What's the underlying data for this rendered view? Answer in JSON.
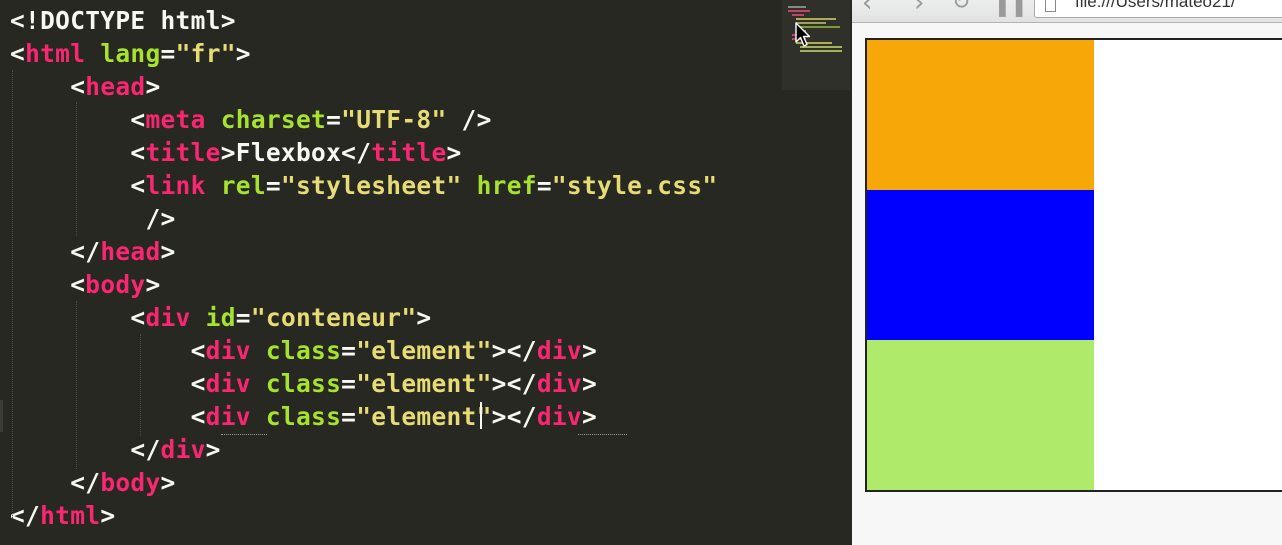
{
  "editor": {
    "lines": [
      [
        {
          "t": "<!DOCTYPE html>",
          "c": "text"
        }
      ],
      [
        {
          "t": "<",
          "c": "pun"
        },
        {
          "t": "html",
          "c": "tag"
        },
        {
          "t": " ",
          "c": "pun"
        },
        {
          "t": "lang",
          "c": "attr"
        },
        {
          "t": "=",
          "c": "pun"
        },
        {
          "t": "\"fr\"",
          "c": "str"
        },
        {
          "t": ">",
          "c": "pun"
        }
      ],
      [
        {
          "t": "    <",
          "c": "pun"
        },
        {
          "t": "head",
          "c": "tag"
        },
        {
          "t": ">",
          "c": "pun"
        }
      ],
      [
        {
          "t": "        <",
          "c": "pun"
        },
        {
          "t": "meta",
          "c": "tag"
        },
        {
          "t": " ",
          "c": "pun"
        },
        {
          "t": "charset",
          "c": "attr"
        },
        {
          "t": "=",
          "c": "pun"
        },
        {
          "t": "\"UTF-8\"",
          "c": "str"
        },
        {
          "t": " />",
          "c": "pun"
        }
      ],
      [
        {
          "t": "        <",
          "c": "pun"
        },
        {
          "t": "title",
          "c": "tag"
        },
        {
          "t": ">",
          "c": "pun"
        },
        {
          "t": "Flexbox",
          "c": "text"
        },
        {
          "t": "</",
          "c": "pun"
        },
        {
          "t": "title",
          "c": "tag"
        },
        {
          "t": ">",
          "c": "pun"
        }
      ],
      [
        {
          "t": "        <",
          "c": "pun"
        },
        {
          "t": "link",
          "c": "tag"
        },
        {
          "t": " ",
          "c": "pun"
        },
        {
          "t": "rel",
          "c": "attr"
        },
        {
          "t": "=",
          "c": "pun"
        },
        {
          "t": "\"stylesheet\"",
          "c": "str"
        },
        {
          "t": " ",
          "c": "pun"
        },
        {
          "t": "href",
          "c": "attr"
        },
        {
          "t": "=",
          "c": "pun"
        },
        {
          "t": "\"style.css\"",
          "c": "str"
        }
      ],
      [
        {
          "t": "         />",
          "c": "pun"
        }
      ],
      [
        {
          "t": "    </",
          "c": "pun"
        },
        {
          "t": "head",
          "c": "tag"
        },
        {
          "t": ">",
          "c": "pun"
        }
      ],
      [
        {
          "t": "    <",
          "c": "pun"
        },
        {
          "t": "body",
          "c": "tag"
        },
        {
          "t": ">",
          "c": "pun"
        }
      ],
      [
        {
          "t": "        <",
          "c": "pun"
        },
        {
          "t": "div",
          "c": "tag"
        },
        {
          "t": " ",
          "c": "pun"
        },
        {
          "t": "id",
          "c": "attr"
        },
        {
          "t": "=",
          "c": "pun"
        },
        {
          "t": "\"conteneur\"",
          "c": "str"
        },
        {
          "t": ">",
          "c": "pun"
        }
      ],
      [
        {
          "t": "            <",
          "c": "pun"
        },
        {
          "t": "div",
          "c": "tag"
        },
        {
          "t": " ",
          "c": "pun"
        },
        {
          "t": "class",
          "c": "attr"
        },
        {
          "t": "=",
          "c": "pun"
        },
        {
          "t": "\"element\"",
          "c": "str"
        },
        {
          "t": "></",
          "c": "pun"
        },
        {
          "t": "div",
          "c": "tag"
        },
        {
          "t": ">",
          "c": "pun"
        }
      ],
      [
        {
          "t": "            <",
          "c": "pun"
        },
        {
          "t": "div",
          "c": "tag"
        },
        {
          "t": " ",
          "c": "pun"
        },
        {
          "t": "class",
          "c": "attr"
        },
        {
          "t": "=",
          "c": "pun"
        },
        {
          "t": "\"element\"",
          "c": "str"
        },
        {
          "t": "></",
          "c": "pun"
        },
        {
          "t": "div",
          "c": "tag"
        },
        {
          "t": ">",
          "c": "pun"
        }
      ],
      [
        {
          "t": "            <",
          "c": "pun"
        },
        {
          "t": "div",
          "c": "tag"
        },
        {
          "t": " ",
          "c": "pun"
        },
        {
          "t": "class",
          "c": "attr"
        },
        {
          "t": "=",
          "c": "pun"
        },
        {
          "t": "\"element\"",
          "c": "str"
        },
        {
          "t": "></",
          "c": "pun"
        },
        {
          "t": "div",
          "c": "tag"
        },
        {
          "t": ">",
          "c": "pun"
        }
      ],
      [
        {
          "t": "        </",
          "c": "pun"
        },
        {
          "t": "div",
          "c": "tag"
        },
        {
          "t": ">",
          "c": "pun"
        }
      ],
      [
        {
          "t": "    </",
          "c": "pun"
        },
        {
          "t": "body",
          "c": "tag"
        },
        {
          "t": ">",
          "c": "pun"
        }
      ],
      [
        {
          "t": "</",
          "c": "pun"
        },
        {
          "t": "html",
          "c": "tag"
        },
        {
          "t": ">",
          "c": "pun"
        }
      ]
    ],
    "colors": {
      "background": "#272822",
      "tag": "#f92672",
      "attribute": "#a6e22e",
      "string": "#e6db74",
      "text": "#f8f8f2"
    }
  },
  "browser": {
    "url": "file:///Users/mateo21/",
    "nav_icons": [
      "back-icon",
      "forward-icon",
      "reload-icon",
      "pause-icon"
    ],
    "flex_items": [
      {
        "name": "flex-item-orange",
        "color": "#f7a808"
      },
      {
        "name": "flex-item-blue",
        "color": "#0000ff"
      },
      {
        "name": "flex-item-green",
        "color": "#b0ea6a"
      }
    ]
  }
}
